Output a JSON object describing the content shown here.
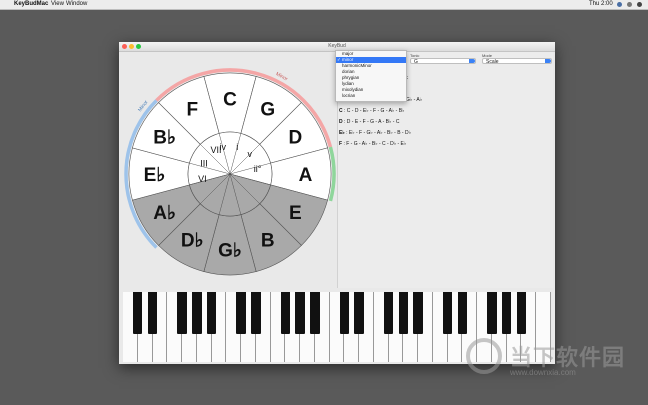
{
  "menubar": {
    "app": "KeyBudMac",
    "view": "View",
    "window": "Window",
    "clock": "Thu 2:00"
  },
  "window": {
    "title": "KeyBud"
  },
  "wheel": {
    "outer_keys": [
      "C",
      "G",
      "D",
      "A",
      "E",
      "B",
      "G♭",
      "D♭",
      "A♭",
      "E♭",
      "B♭",
      "F"
    ],
    "degrees": [
      "iv",
      "i",
      "v",
      "ii°",
      "VI",
      "III",
      "VII"
    ],
    "arc_labels": {
      "minor_left": "Minor",
      "minor_top": "Minor",
      "dim": "Dim"
    },
    "colors": {
      "major_arc": "#f4a6a6",
      "minor_arc": "#9ec3ea",
      "dim_arc": "#8fd69b",
      "shaded": "#a9a9a9"
    }
  },
  "controls": {
    "tonic_label": "Tonic",
    "tonic_value": "G",
    "mode_label": "Mode",
    "mode_value": "Scale"
  },
  "mode_dropdown": {
    "items": [
      "major",
      "minor",
      "harmonicMinor",
      "dorian",
      "phrygian",
      "lydian",
      "mixolydian",
      "locrian"
    ],
    "selected": "minor"
  },
  "scales": [
    {
      "key": "",
      "notes": "- F"
    },
    {
      "key": "",
      "notes": "G"
    },
    {
      "key": "",
      "notes": "G♭ - A♭"
    },
    {
      "key": "C",
      "notes": ": C - D - E♭ - F - G - A♭ - B♭"
    },
    {
      "key": "D",
      "notes": ": D - E - F - G - A - B♭ - C"
    },
    {
      "key": "E♭",
      "notes": ": E♭ - F - G♭ - A♭ - B♭ - B - D♭"
    },
    {
      "key": "F",
      "notes": ": F - G - A♭ - B♭ - C - D♭ - E♭"
    }
  ],
  "watermark": {
    "text": "当下软件园",
    "url": "www.downxia.com"
  }
}
